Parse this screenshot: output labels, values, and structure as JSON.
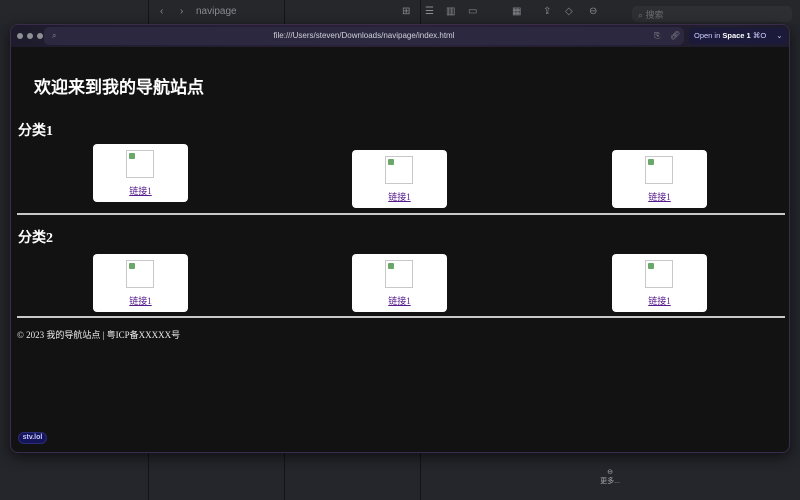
{
  "finder": {
    "folder": "navipage",
    "search_placeholder": "搜索",
    "more_label": "更多..."
  },
  "browser": {
    "url": "file:///Users/steven/Downloads/navipage/index.html",
    "open_in_prefix": "Open in",
    "open_in_space": "Space 1",
    "shortcut": "⌘O"
  },
  "page": {
    "title": "欢迎来到我的导航站点",
    "categories": [
      {
        "name": "分类1",
        "links": [
          {
            "label": "链接1"
          },
          {
            "label": "链接1"
          },
          {
            "label": "链接1"
          }
        ]
      },
      {
        "name": "分类2",
        "links": [
          {
            "label": "链接1"
          },
          {
            "label": "链接1"
          },
          {
            "label": "链接1"
          }
        ]
      }
    ],
    "footer": "© 2023 我的导航站点 | 粤ICP备XXXXX号"
  },
  "badge": "stv.lol",
  "colors": {
    "background": "#121212",
    "link": "#551a8b",
    "card": "#ffffff"
  }
}
